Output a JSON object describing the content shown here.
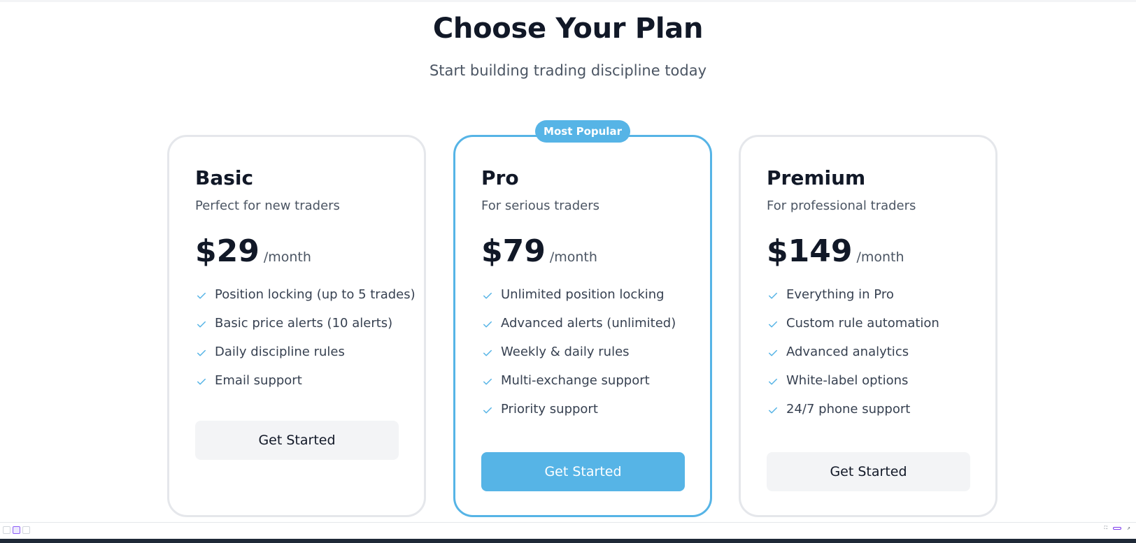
{
  "header": {
    "title": "Choose Your Plan",
    "subtitle": "Start building trading discipline today"
  },
  "badge": "Most Popular",
  "accent_color": "#56b4e6",
  "plans": [
    {
      "name": "Basic",
      "description": "Perfect for new traders",
      "price": "$29",
      "period": "/month",
      "features": [
        "Position locking (up to 5 trades)",
        "Basic price alerts (10 alerts)",
        "Daily discipline rules",
        "Email support"
      ],
      "cta": "Get Started"
    },
    {
      "name": "Pro",
      "description": "For serious traders",
      "price": "$79",
      "period": "/month",
      "features": [
        "Unlimited position locking",
        "Advanced alerts (unlimited)",
        "Weekly & daily rules",
        "Multi-exchange support",
        "Priority support"
      ],
      "cta": "Get Started"
    },
    {
      "name": "Premium",
      "description": "For professional traders",
      "price": "$149",
      "period": "/month",
      "features": [
        "Everything in Pro",
        "Custom rule automation",
        "Advanced analytics",
        "White-label options",
        "24/7 phone support"
      ],
      "cta": "Get Started"
    }
  ],
  "icons": {
    "feature": "check-icon"
  }
}
